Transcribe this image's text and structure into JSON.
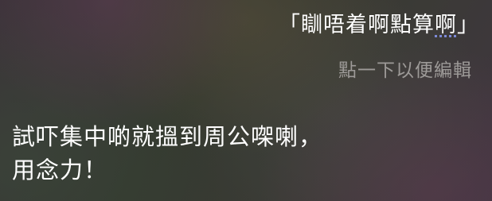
{
  "query": {
    "open_quote": "「",
    "text_main": "瞓唔着啊點算",
    "text_underlined": "啊",
    "close_quote": "」"
  },
  "edit_hint": "點一下以便編輯",
  "response": {
    "line1": "試吓集中啲就搵到周公㗎喇，",
    "line2": "用念力！"
  }
}
